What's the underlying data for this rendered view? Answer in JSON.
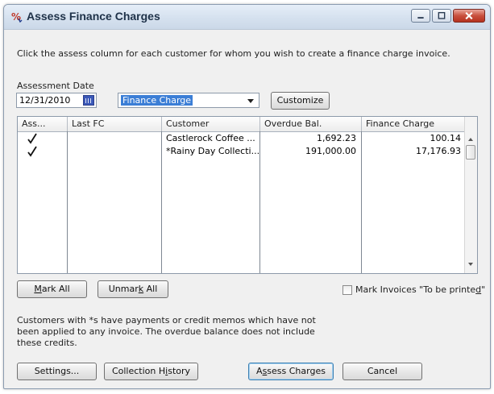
{
  "window": {
    "title": "Assess Finance Charges"
  },
  "instructions": "Click the assess column for each customer for whom you wish to create a finance charge invoice.",
  "assessment_date": {
    "label": "Assessment Date",
    "value": "12/31/2010"
  },
  "template": {
    "selected": "Finance Charge"
  },
  "buttons": {
    "customize": "Customize",
    "mark_all": "Mark All",
    "unmark_all": "Unmark All",
    "settings": "Settings...",
    "collection_history": "Collection History",
    "assess_charges": "Assess Charges",
    "cancel": "Cancel"
  },
  "table": {
    "columns": [
      "Ass...",
      "Last FC",
      "Customer",
      "Overdue Bal.",
      "Finance Charge"
    ],
    "rows": [
      {
        "assess": true,
        "last_fc": "",
        "customer": "Castlerock Coffee ...",
        "overdue_bal": "1,692.23",
        "finance_charge": "100.14"
      },
      {
        "assess": true,
        "last_fc": "",
        "customer": "*Rainy Day Collecti...",
        "overdue_bal": "191,000.00",
        "finance_charge": "17,176.93"
      }
    ]
  },
  "mark_to_be_printed": {
    "label": "Mark Invoices \"To be printed\"",
    "checked": false
  },
  "footnote": "Customers with *s have payments or credit memos which have not been applied to any invoice.  The overdue balance does not include these credits.",
  "icons": {
    "app": "finance-charge-icon",
    "calendar": "calendar-icon",
    "check": "check-icon"
  },
  "colors": {
    "titlebar": "#d5e1ef",
    "selection": "#3b7ed6",
    "close_button": "#c9503e"
  }
}
